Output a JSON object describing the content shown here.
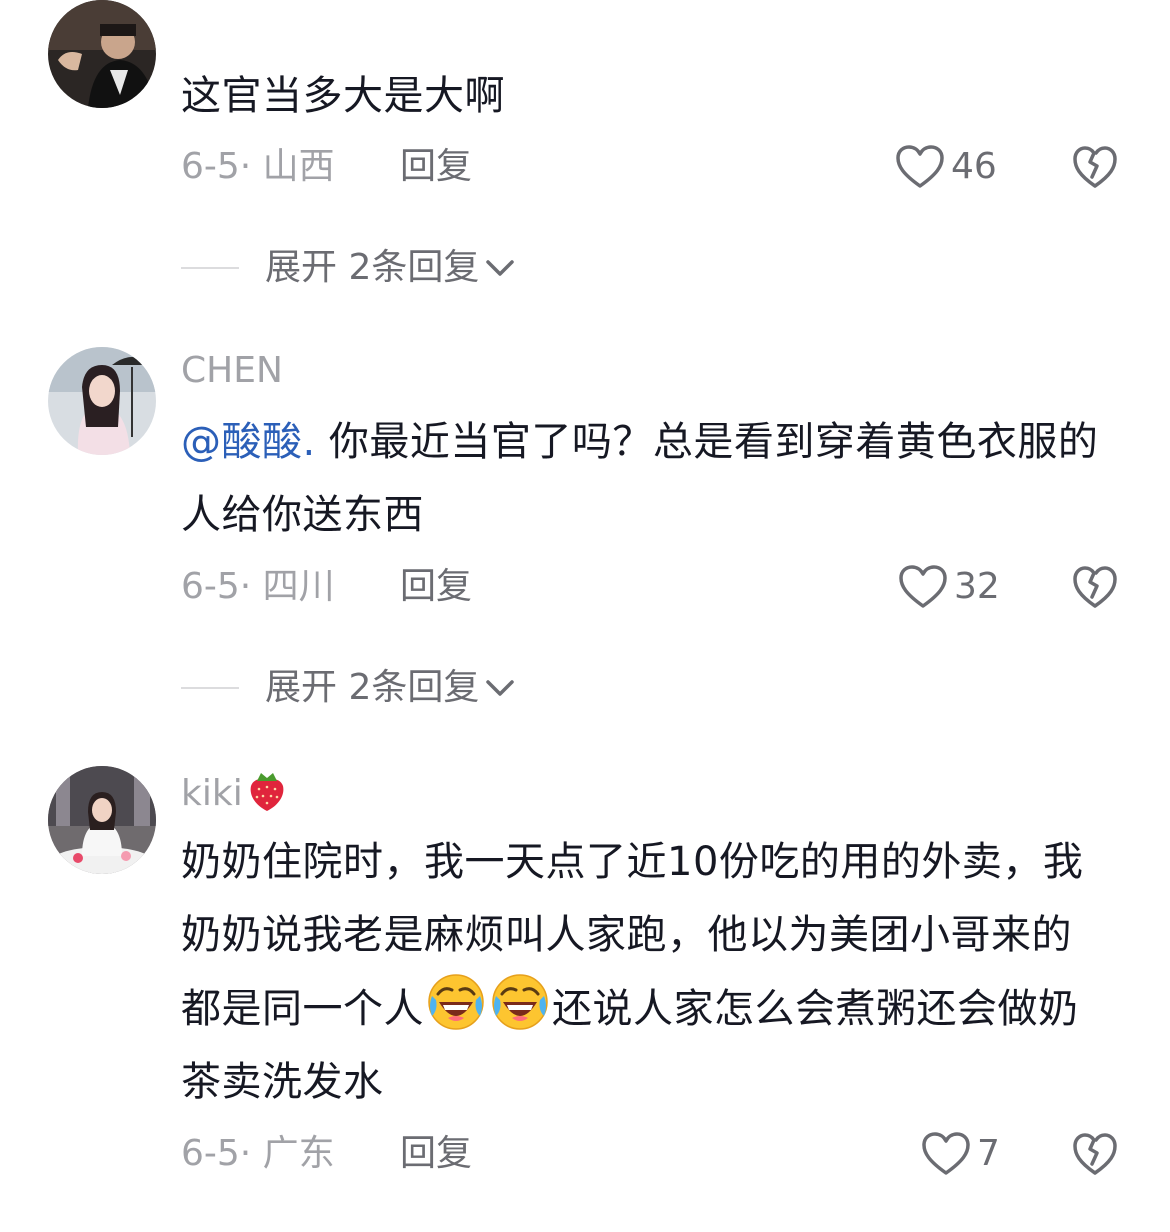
{
  "comments": [
    {
      "username": "",
      "text": "这官当多大是大啊",
      "date_location": "6-5· 山西",
      "reply_label": "回复",
      "likes": "46",
      "expand_label": "展开 2条回复"
    },
    {
      "username": "CHEN",
      "mention": "@酸酸.",
      "text": " 你最近当官了吗？总是看到穿着黄色衣服的人给你送东西",
      "date_location": "6-5· 四川",
      "reply_label": "回复",
      "likes": "32",
      "expand_label": "展开 2条回复"
    },
    {
      "username": "kiki",
      "username_emoji": "strawberry",
      "text_part1": "奶奶住院时，我一天点了近10份吃的用的外卖，我奶奶说我老是麻烦叫人家跑，他以为美团小哥来的都是同一个人",
      "text_emoji": "rolling-on-floor-laughing",
      "text_part2": "还说人家怎么会煮粥还会做奶茶卖洗发水",
      "date_location": "6-5· 广东",
      "reply_label": "回复",
      "likes": "7"
    }
  ],
  "icons": {
    "like": "heart-outline-icon",
    "dislike": "broken-heart-icon",
    "expand": "chevron-down-icon"
  },
  "colors": {
    "text": "#161823",
    "secondary": "#a1a2a7",
    "mention": "#2b5fb8"
  }
}
